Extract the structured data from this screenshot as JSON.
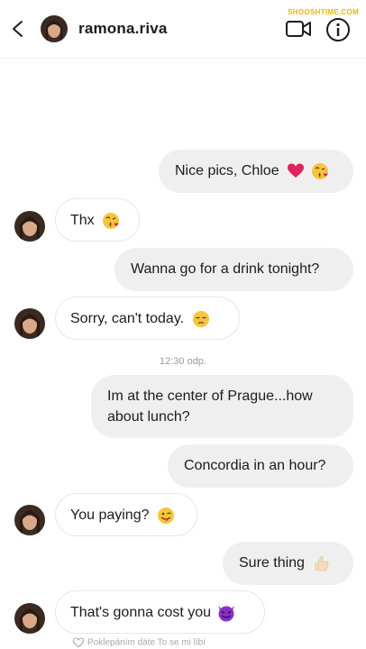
{
  "header": {
    "username": "ramona.riva",
    "watermark": "SHOOSHTIME.COM",
    "icons": [
      "back-arrow-icon",
      "video-call-icon",
      "info-icon"
    ]
  },
  "messages": [
    {
      "side": "out",
      "text": "Nice pics, Chloe",
      "emoji": [
        "red-heart-emoji",
        "kissing-face-emoji"
      ]
    },
    {
      "side": "in",
      "text": "Thx",
      "emoji": [
        "kissing-face-emoji"
      ]
    },
    {
      "side": "out",
      "text": "Wanna go for a drink tonight?"
    },
    {
      "side": "in",
      "text": "Sorry, can't today.",
      "emoji": [
        "pensive-face-emoji"
      ]
    },
    {
      "side": "out",
      "text_line1": "Im at the center of Prague...how",
      "text_line2": "about lunch?"
    },
    {
      "side": "out",
      "text": "Concordia in an hour?"
    },
    {
      "side": "in",
      "text": "You paying?",
      "emoji": [
        "winking-tongue-face-emoji"
      ]
    },
    {
      "side": "out",
      "text": "Sure thing",
      "emoji": [
        "thumbs-up-emoji"
      ]
    },
    {
      "side": "in",
      "text": "That's gonna cost you",
      "emoji": [
        "smiling-devil-emoji"
      ]
    }
  ],
  "timestamp": "12:30 odp.",
  "footer_hint": "Poklepáním dáte To se mi líbí",
  "colors": {
    "outgoing_bubble": "#efefef",
    "incoming_border": "#e6e6e6",
    "heart": "#e0245e",
    "emoji_yellow": "#f7c53c",
    "devil_purple": "#8b2fc9"
  }
}
